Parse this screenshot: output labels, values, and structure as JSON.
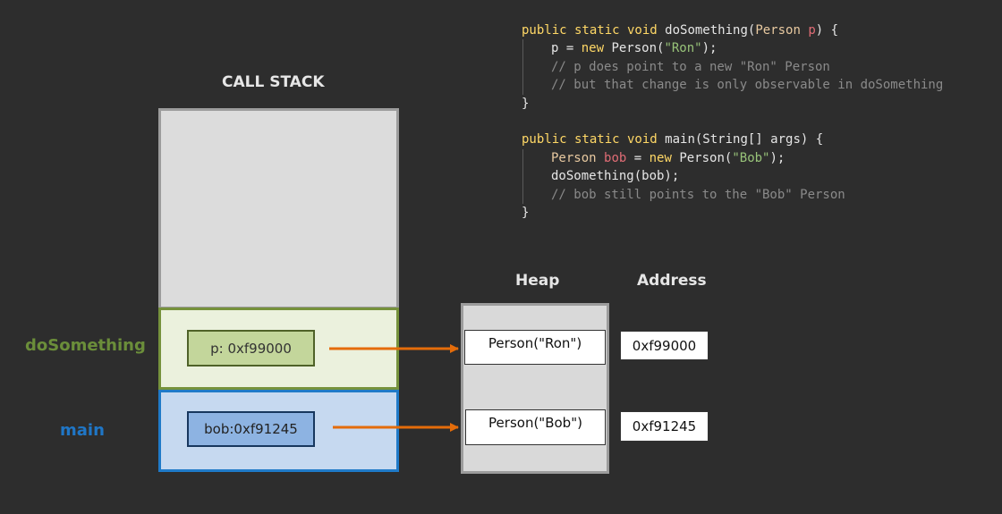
{
  "titles": {
    "call_stack": "CALL STACK",
    "heap": "Heap",
    "address": "Address"
  },
  "frames": {
    "dosomething_label": "doSomething",
    "main_label": "main"
  },
  "variables": {
    "p": "p: 0xf99000",
    "bob": "bob:0xf91245"
  },
  "heap": {
    "objects": [
      {
        "label": "Person(\"Ron\")",
        "address": "0xf99000"
      },
      {
        "label": "Person(\"Bob\")",
        "address": "0xf91245"
      }
    ]
  },
  "code": {
    "lines": [
      {
        "indent": false,
        "tokens": [
          {
            "t": "public static void ",
            "c": "kw"
          },
          {
            "t": "doSomething(",
            "c": "pl"
          },
          {
            "t": "Person ",
            "c": "tp"
          },
          {
            "t": "p",
            "c": "pr"
          },
          {
            "t": ") {",
            "c": "pl"
          }
        ]
      },
      {
        "indent": true,
        "tokens": [
          {
            "t": "p = ",
            "c": "pl"
          },
          {
            "t": "new ",
            "c": "kw"
          },
          {
            "t": "Person(",
            "c": "pl"
          },
          {
            "t": "\"Ron\"",
            "c": "st"
          },
          {
            "t": ");",
            "c": "pl"
          }
        ]
      },
      {
        "indent": true,
        "tokens": [
          {
            "t": "// p does point to a new \"Ron\" Person",
            "c": "cm"
          }
        ]
      },
      {
        "indent": true,
        "tokens": [
          {
            "t": "// but that change is only observable in doSomething",
            "c": "cm"
          }
        ]
      },
      {
        "indent": false,
        "tokens": [
          {
            "t": "}",
            "c": "pl"
          }
        ]
      },
      {
        "indent": false,
        "tokens": []
      },
      {
        "indent": false,
        "tokens": [
          {
            "t": "public static void ",
            "c": "kw"
          },
          {
            "t": "main(String[] args) {",
            "c": "pl"
          }
        ]
      },
      {
        "indent": true,
        "tokens": [
          {
            "t": "Person ",
            "c": "tp"
          },
          {
            "t": "bob",
            "c": "pr"
          },
          {
            "t": " = ",
            "c": "pl"
          },
          {
            "t": "new ",
            "c": "kw"
          },
          {
            "t": "Person(",
            "c": "pl"
          },
          {
            "t": "\"Bob\"",
            "c": "st"
          },
          {
            "t": ");",
            "c": "pl"
          }
        ]
      },
      {
        "indent": true,
        "tokens": [
          {
            "t": "doSomething(bob);",
            "c": "pl"
          }
        ]
      },
      {
        "indent": true,
        "tokens": [
          {
            "t": "// bob still points to the \"Bob\" Person",
            "c": "cm"
          }
        ]
      },
      {
        "indent": false,
        "tokens": [
          {
            "t": "}",
            "c": "pl"
          }
        ]
      }
    ]
  },
  "colors": {
    "arrow": "#e46c0a",
    "background": "#2d2d2d",
    "dosomething_frame": "#76923c",
    "main_frame": "#1f7ac8"
  }
}
